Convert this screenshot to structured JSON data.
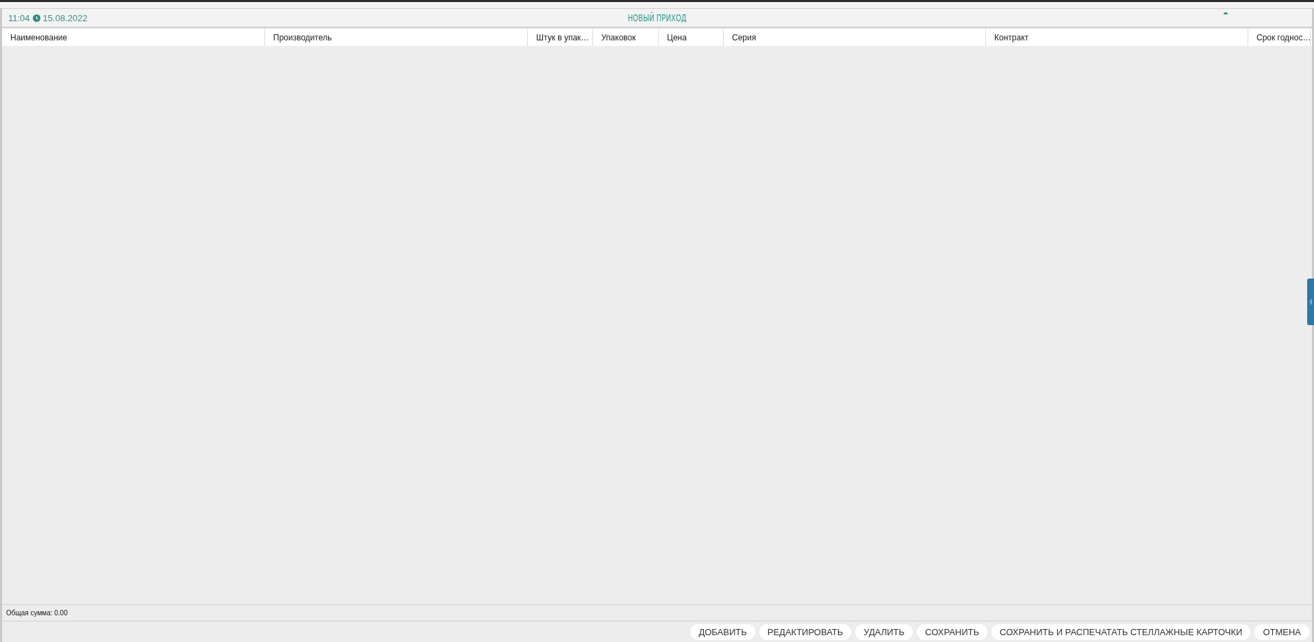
{
  "header": {
    "time": "11:04",
    "date": "15.08.2022",
    "title": "НОВЫЙ ПРИХОД"
  },
  "table": {
    "columns": [
      {
        "label": "Наименование"
      },
      {
        "label": "Производитель"
      },
      {
        "label": "Штук в упак…"
      },
      {
        "label": "Упаковок"
      },
      {
        "label": "Цена"
      },
      {
        "label": "Серия"
      },
      {
        "label": "Контракт"
      },
      {
        "label": "Срок годнос…"
      }
    ]
  },
  "footer": {
    "total": "Общая сумма: 0.00"
  },
  "buttons": [
    "ДОБАВИТЬ",
    "РЕДАКТИРОВАТЬ",
    "УДАЛИТЬ",
    "СОХРАНИТЬ",
    "СОХРАНИТЬ И РАСПЕЧАТАТЬ СТЕЛЛАЖНЫЕ КАРТОЧКИ",
    "ОТМЕНА"
  ]
}
